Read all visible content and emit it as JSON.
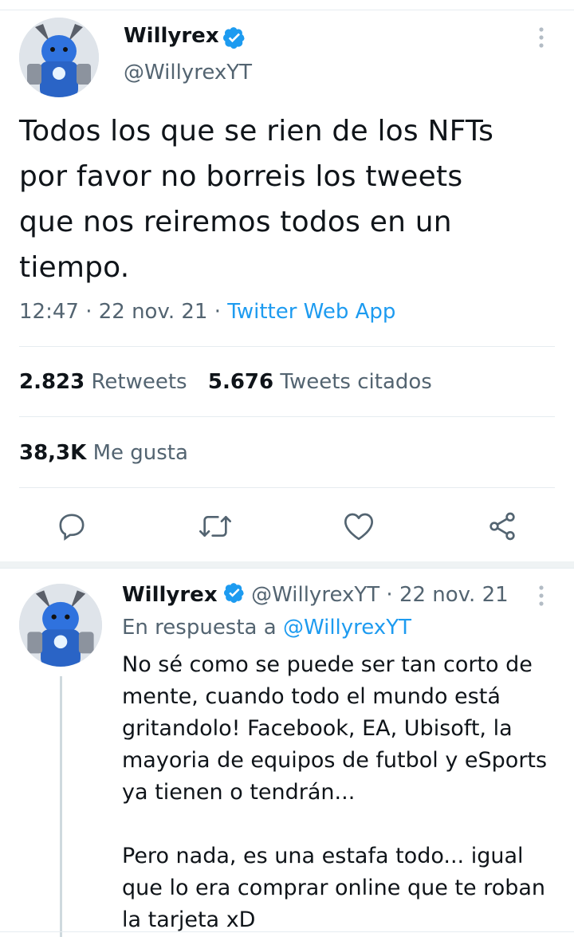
{
  "tweet": {
    "author": {
      "name": "Willyrex",
      "handle": "@WillyrexYT",
      "verified": true
    },
    "text": [
      "Todos los que se rien de los NFTs",
      "por favor no borreis los tweets",
      "que nos reiremos todos en un",
      "tiempo."
    ],
    "time": "12:47",
    "separator": "·",
    "date": "22 nov. 21",
    "source": "Twitter Web App",
    "stats": {
      "retweets_count": "2.823",
      "retweets_label": "Retweets",
      "quotes_count": "5.676",
      "quotes_label": "Tweets citados",
      "likes_count": "38,3K",
      "likes_label": "Me gusta"
    },
    "actions": [
      "reply-icon",
      "retweet-icon",
      "like-icon",
      "share-icon"
    ]
  },
  "reply": {
    "author": {
      "name": "Willyrex",
      "handle": "@WillyrexYT",
      "verified": true
    },
    "separator": "·",
    "date": "22 nov. 21",
    "in_reply_label": "En respuesta a",
    "in_reply_mention": "@WillyrexYT",
    "text": [
      "No sé como se puede ser tan corto de",
      "mente, cuando todo el mundo está",
      "gritandolo! Facebook, EA, Ubisoft, la",
      "mayoria de equipos de futbol y eSports",
      "ya tienen o tendrán...",
      "",
      "Pero nada, es una estafa todo... igual",
      "que lo era comprar online que te roban",
      "la tarjeta xD"
    ]
  },
  "colors": {
    "accent": "#1d9bf0",
    "text": "#0f1419",
    "secondary": "#536471",
    "divider": "#e6ecf0"
  }
}
